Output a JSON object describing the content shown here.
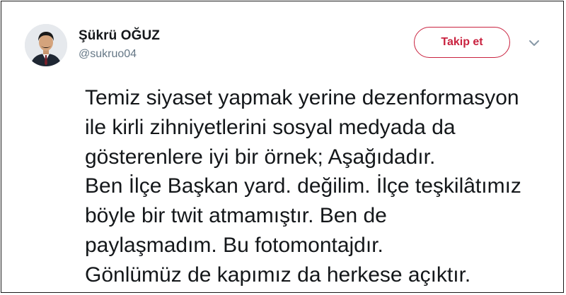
{
  "author": {
    "display_name": "Şükrü OĞUZ",
    "handle": "@sukruo04",
    "avatar_icon": "profile-photo"
  },
  "actions": {
    "follow_label": "Takip et",
    "more_icon": "chevron-down-icon"
  },
  "tweet": {
    "lines": [
      "Temiz siyaset yapmak yerine dezenformasyon",
      "ile kirli zihniyetlerini sosyal medyada da",
      "gösterenlere iyi bir örnek; Aşağıdadır.",
      "Ben İlçe Başkan yard. değilim. İlçe teşkilâtımız",
      "böyle bir twit atmamıştır. Ben de",
      "paylaşmadım. Bu fotomontajdır.",
      "Gönlümüz de kapımız da herkese açıktır."
    ]
  },
  "colors": {
    "accent": "#c9223f",
    "text": "#14171a",
    "muted": "#657786",
    "border": "#1a1a1a"
  }
}
